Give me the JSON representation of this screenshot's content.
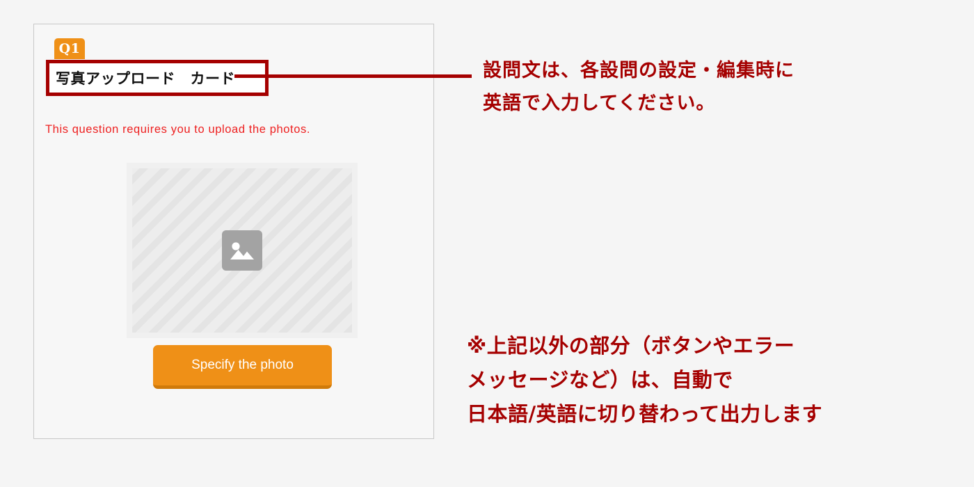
{
  "colors": {
    "page_background": "#f5f5f5",
    "card_background": "#f7f7f7",
    "card_border": "#c8c8c8",
    "accent_orange": "#ef9017",
    "accent_orange_dark": "#d07a0a",
    "annotation_red": "#a50000",
    "error_red": "#ee2020",
    "placeholder_gray": "#eaeaea",
    "icon_gray": "#a3a3a3"
  },
  "question_card": {
    "badge_label": "Q1",
    "question_title": "写真アップロード　カード",
    "error_message": "This question requires you to upload the photos.",
    "photo_placeholder": {
      "icon_name": "image-placeholder-icon"
    },
    "specify_button_label": "Specify the photo"
  },
  "annotations": {
    "title_note": {
      "lines": [
        "設問文は、各設問の設定・編集時に",
        "英語で入力してください。"
      ]
    },
    "auto_note": {
      "lines": [
        "※上記以外の部分（ボタンやエラー",
        "メッセージなど）は、自動で",
        "日本語/英語に切り替わって出力します"
      ]
    }
  }
}
